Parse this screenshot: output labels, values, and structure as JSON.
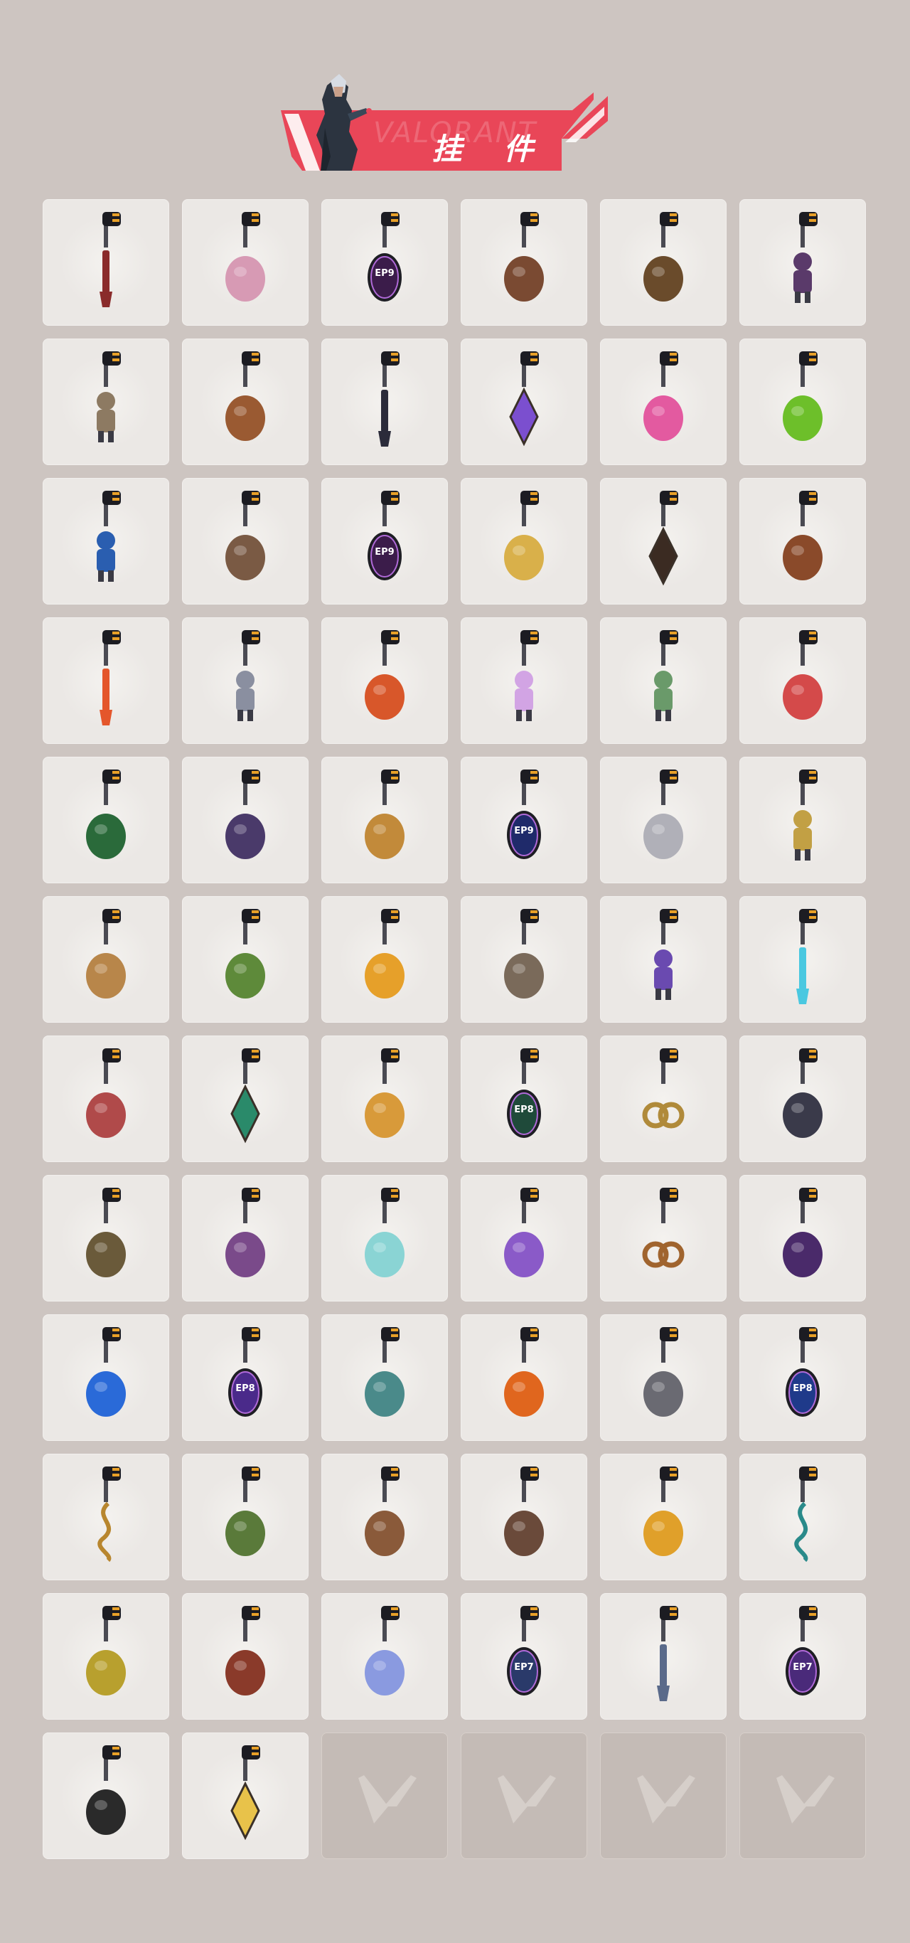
{
  "header": {
    "title": "挂 件",
    "watermark": "VALORANT",
    "accent_color": "#e94658"
  },
  "grid": {
    "rows": 12,
    "columns": 6,
    "filled_count": 68,
    "empty_count": 4
  },
  "items": [
    {
      "icon": "braided-lanyard-buddy-icon",
      "color": "#8a2b2b"
    },
    {
      "icon": "cupcake-buddy-icon",
      "color": "#d79ab4"
    },
    {
      "icon": "ep9-medal-buddy-icon",
      "color": "#3b1c4a"
    },
    {
      "icon": "teddy-bear-buddy-icon",
      "color": "#7a4a32"
    },
    {
      "icon": "turret-buddy-icon",
      "color": "#6a4b2b"
    },
    {
      "icon": "agent-figure-buddy-icon",
      "color": "#5a3a6a"
    },
    {
      "icon": "cowboy-figure-buddy-icon",
      "color": "#8d7a62"
    },
    {
      "icon": "crate-buddy-icon",
      "color": "#9a5a32"
    },
    {
      "icon": "raven-tassel-buddy-icon",
      "color": "#2b2b3a"
    },
    {
      "icon": "crystal-buddy-icon",
      "color": "#7b4fcf"
    },
    {
      "icon": "lava-lamp-buddy-icon",
      "color": "#e35aa0"
    },
    {
      "icon": "pager-buddy-icon",
      "color": "#6dbf2a"
    },
    {
      "icon": "robot-buddy-icon",
      "color": "#2a5eb0"
    },
    {
      "icon": "radio-buddy-icon",
      "color": "#7a5a44"
    },
    {
      "icon": "ep9-medal-buddy-icon",
      "color": "#3b1c4a"
    },
    {
      "icon": "cheese-buddy-icon",
      "color": "#d9b04a"
    },
    {
      "icon": "ninja-star-buddy-icon",
      "color": "#3b2b22"
    },
    {
      "icon": "popsicle-buddy-icon",
      "color": "#8a4a2a"
    },
    {
      "icon": "lantern-chain-buddy-icon",
      "color": "#e4562b"
    },
    {
      "icon": "agent-chibi-buddy-icon",
      "color": "#8a8fa0"
    },
    {
      "icon": "hot-air-balloon-buddy-icon",
      "color": "#d8572a"
    },
    {
      "icon": "pink-hair-chibi-buddy-icon",
      "color": "#d2a4e4"
    },
    {
      "icon": "green-robot-buddy-icon",
      "color": "#6a9a6a"
    },
    {
      "icon": "watermelon-buddy-icon",
      "color": "#d44a4a"
    },
    {
      "icon": "soda-can-buddy-icon",
      "color": "#2a6a3a"
    },
    {
      "icon": "lantern-buddy-icon",
      "color": "#4a3a6a"
    },
    {
      "icon": "beehive-buddy-icon",
      "color": "#c28a3a"
    },
    {
      "icon": "ep9-medal-buddy-icon",
      "color": "#1f2a6a"
    },
    {
      "icon": "wave-buddy-icon",
      "color": "#b0b0b8"
    },
    {
      "icon": "gold-mech-buddy-icon",
      "color": "#c2a044"
    },
    {
      "icon": "sloth-buddy-icon",
      "color": "#b8864a"
    },
    {
      "icon": "plant-skull-buddy-icon",
      "color": "#5e8a3a"
    },
    {
      "icon": "flame-torch-buddy-icon",
      "color": "#e6a02a"
    },
    {
      "icon": "raccoon-buddy-icon",
      "color": "#7a6a5a"
    },
    {
      "icon": "samurai-mech-buddy-icon",
      "color": "#6a4ab0"
    },
    {
      "icon": "energy-sword-buddy-icon",
      "color": "#4ac8e0"
    },
    {
      "icon": "octopus-buddy-icon",
      "color": "#b04a4a"
    },
    {
      "icon": "green-gem-buddy-icon",
      "color": "#2a8a6a"
    },
    {
      "icon": "sun-cloud-buddy-icon",
      "color": "#d89a3a"
    },
    {
      "icon": "ep8-medal-buddy-icon",
      "color": "#1f4a3a"
    },
    {
      "icon": "pretzel-buddy-icon",
      "color": "#b08a3a"
    },
    {
      "icon": "penguin-claw-buddy-icon",
      "color": "#3a3a4a"
    },
    {
      "icon": "message-bottle-buddy-icon",
      "color": "#6a5a3a"
    },
    {
      "icon": "jet-ski-buddy-icon",
      "color": "#7a4a8a"
    },
    {
      "icon": "ufo-jellyfish-buddy-icon",
      "color": "#8ad4d4"
    },
    {
      "icon": "lotus-flame-buddy-icon",
      "color": "#8a5ac8"
    },
    {
      "icon": "pretzel-buddy-icon",
      "color": "#a0642e"
    },
    {
      "icon": "purple-orb-buddy-icon",
      "color": "#4a2a6a"
    },
    {
      "icon": "manta-ray-buddy-icon",
      "color": "#2a6ad8"
    },
    {
      "icon": "ep8-medal-buddy-icon",
      "color": "#4a2a8a"
    },
    {
      "icon": "flying-saucer-buddy-icon",
      "color": "#4a8a8a"
    },
    {
      "icon": "tiger-lantern-buddy-icon",
      "color": "#e0661e"
    },
    {
      "icon": "grey-cat-buddy-icon",
      "color": "#6a6a72"
    },
    {
      "icon": "ep8-medal-buddy-icon",
      "color": "#1f3a8a"
    },
    {
      "icon": "treble-clef-buddy-icon",
      "color": "#b8862e"
    },
    {
      "icon": "campfire-tag-buddy-icon",
      "color": "#5a7a3a"
    },
    {
      "icon": "candy-cone-buddy-icon",
      "color": "#8a5a3a"
    },
    {
      "icon": "cookie-buddy-icon",
      "color": "#6a4a3a"
    },
    {
      "icon": "bee-buddy-icon",
      "color": "#e0a02a"
    },
    {
      "icon": "treble-clef-buddy-icon",
      "color": "#2a8a8a"
    },
    {
      "icon": "genie-lamp-buddy-icon",
      "color": "#b8a02e"
    },
    {
      "icon": "tote-bag-buddy-icon",
      "color": "#8a3a2a"
    },
    {
      "icon": "snowflake-buddy-icon",
      "color": "#8a9ae0"
    },
    {
      "icon": "ep7-medal-buddy-icon",
      "color": "#2a3a6a"
    },
    {
      "icon": "jade-tassel-buddy-icon",
      "color": "#5a6a8a"
    },
    {
      "icon": "ep7-medal-buddy-icon",
      "color": "#4a2a7a"
    },
    {
      "icon": "valorant-logo-buddy-icon",
      "color": "#2a2a2a"
    },
    {
      "icon": "star-egg-buddy-icon",
      "color": "#e8c24a"
    }
  ],
  "empty_slot_icon": "valorant-logo-placeholder-icon"
}
